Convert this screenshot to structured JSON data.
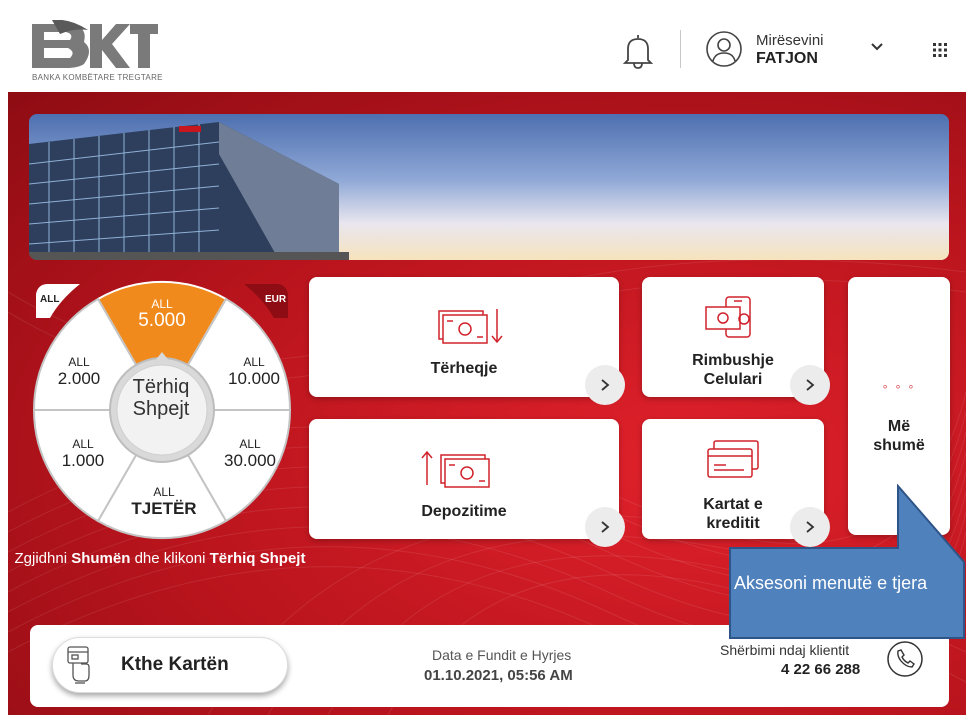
{
  "header": {
    "logo_text": "BKT",
    "logo_tagline": "BANKA KOMBËTARE TREGTARE",
    "greeting": "Mirësevini",
    "user_name": "FATJON",
    "icons": [
      "bell-icon",
      "user-icon",
      "chevron-down-icon",
      "apps-grid-icon"
    ]
  },
  "wheel": {
    "tag_left": "ALL",
    "tag_right": "EUR",
    "segments": [
      {
        "currency": "ALL",
        "amount": "5.000",
        "selected": true
      },
      {
        "currency": "ALL",
        "amount": "10.000"
      },
      {
        "currency": "ALL",
        "amount": "30.000"
      },
      {
        "currency": "ALL",
        "amount": "TJETËR"
      },
      {
        "currency": "ALL",
        "amount": "1.000"
      },
      {
        "currency": "ALL",
        "amount": "2.000"
      }
    ],
    "center_line1": "Tërhiq",
    "center_line2": "Shpejt",
    "instr_pre": "Zgjidhni ",
    "instr_b1": "Shumën",
    "instr_mid": " dhe klikoni ",
    "instr_b2": "Tërhiq Shpejt"
  },
  "tiles": {
    "withdraw": "Tërheqje",
    "deposit": "Depozitime",
    "topup_1": "Rimbushje",
    "topup_2": "Celulari",
    "cards_1": "Kartat e",
    "cards_2": "kreditit",
    "more_1": "Më",
    "more_2": "shumë",
    "more_dots": "◦ ◦ ◦"
  },
  "bottom": {
    "return_card": "Kthe Kartën",
    "last_login_label": "Data e Fundit e Hyrjes",
    "last_login_value": "01.10.2021, 05:56 AM",
    "service_label": "Shërbimi ndaj klientit",
    "service_number": "4 22 66 288"
  },
  "callout": {
    "text": "Aksesoni menutë e tjera"
  },
  "colors": {
    "brand_red": "#c8161f",
    "selected_orange": "#f08a1c",
    "callout_blue": "#4f81bd"
  }
}
